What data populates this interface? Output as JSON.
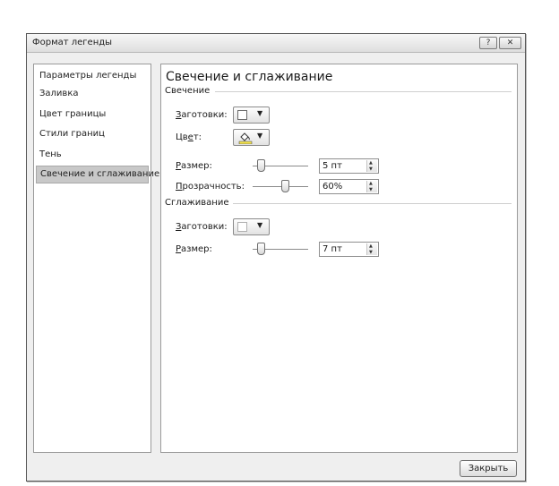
{
  "window": {
    "title": "Формат легенды",
    "help_label": "?",
    "close_label": "✕"
  },
  "nav": {
    "items": [
      {
        "label": "Параметры легенды"
      },
      {
        "label": "Заливка"
      },
      {
        "label": "Цвет границы"
      },
      {
        "label": "Стили границ"
      },
      {
        "label": "Тень"
      },
      {
        "label": "Свечение и сглаживание"
      }
    ],
    "selected_index": 5
  },
  "content": {
    "heading": "Свечение и сглаживание",
    "glow": {
      "section_title": "Свечение",
      "presets": {
        "accel": "З",
        "rest": "аготовки:"
      },
      "color": {
        "pre": "Цв",
        "accel": "е",
        "rest": "т:"
      },
      "size": {
        "accel": "Р",
        "rest": "азмер:",
        "value": "5 пт",
        "slider_fraction": 0.1
      },
      "transparency": {
        "accel": "П",
        "rest": "розрачность:",
        "value": "60%",
        "slider_fraction": 0.6
      }
    },
    "soft": {
      "section_title": "Сглаживание",
      "presets": {
        "accel": "З",
        "rest": "аготовки:"
      },
      "size": {
        "accel": "Р",
        "rest": "азмер:",
        "value": "7 пт",
        "slider_fraction": 0.1
      }
    }
  },
  "footer": {
    "close_label": "Закрыть"
  },
  "colors": {
    "bucket_fill": "#f7e64a",
    "bucket_bar": "#ffffff"
  },
  "icons": {
    "dropdown": "caret-down",
    "spin": "spin-arrows",
    "color": "paint-bucket"
  }
}
